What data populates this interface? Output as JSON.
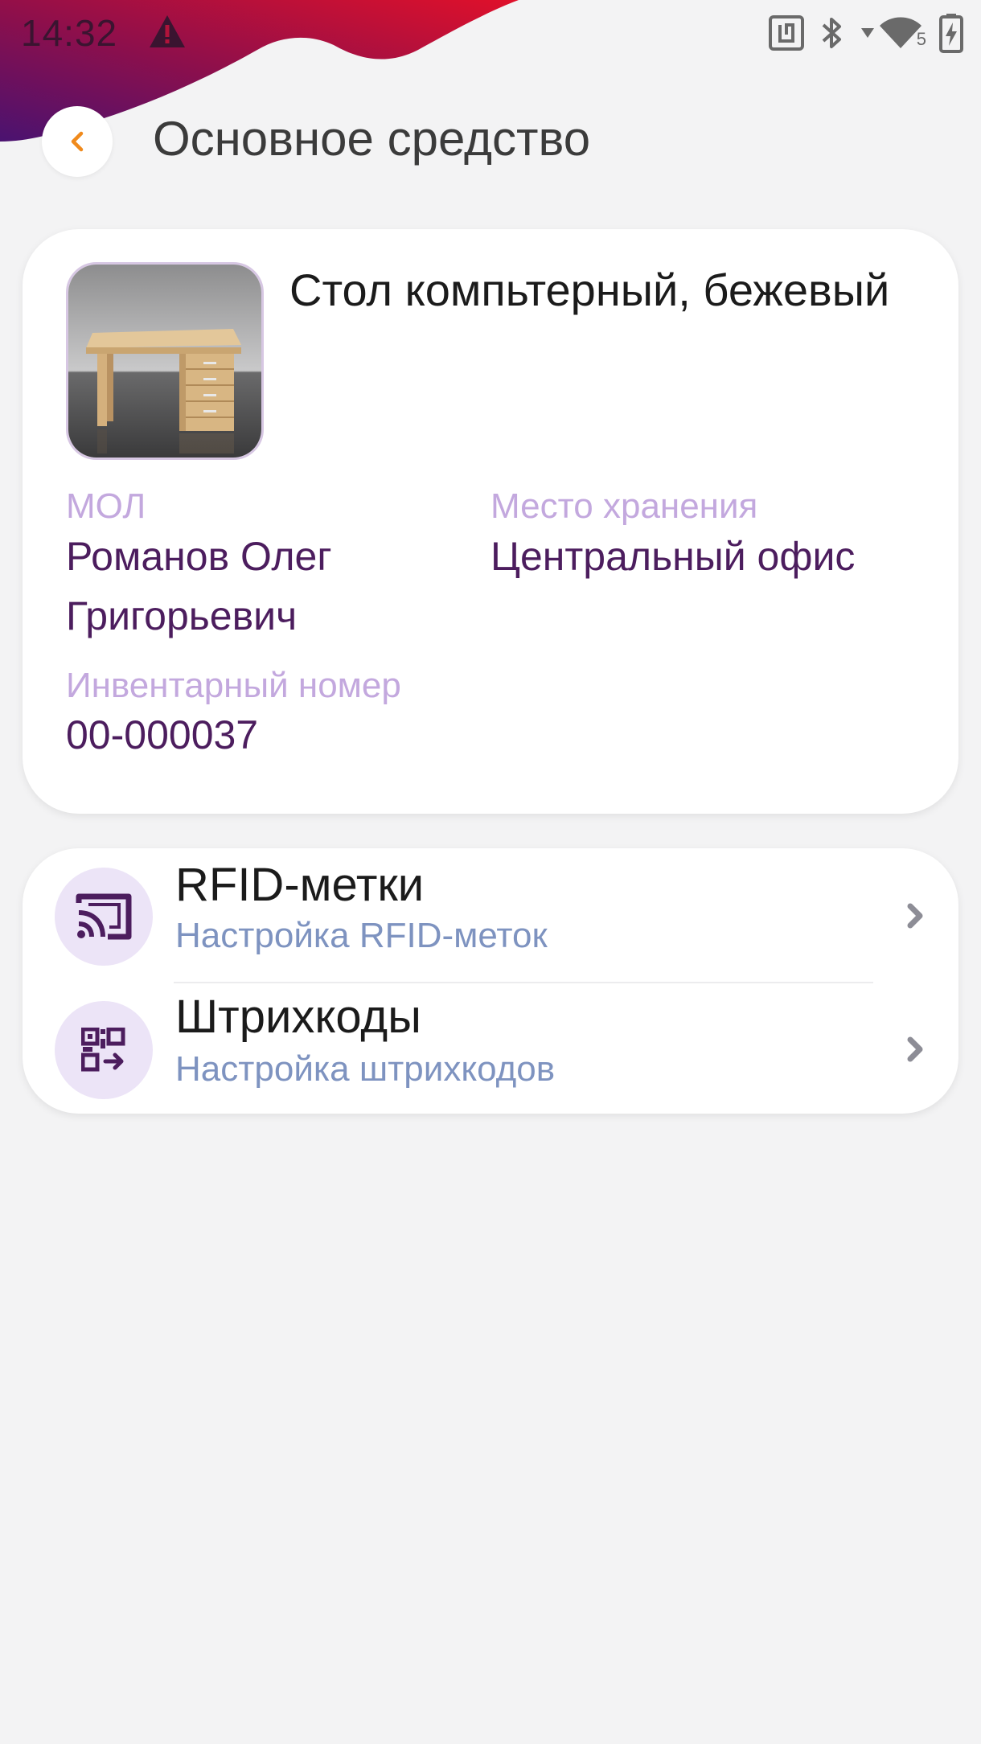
{
  "status_bar": {
    "time": "14:32",
    "icons": [
      "warning-icon",
      "nfc-icon",
      "bluetooth-icon",
      "signal-arrow-icon",
      "wifi-icon",
      "battery-charging-icon"
    ],
    "wifi_badge": "5"
  },
  "header": {
    "back_icon": "chevron-left-icon",
    "title": "Основное средство"
  },
  "asset": {
    "name": "Стол компьтерный, бежевый",
    "image": "computer-desk-beige",
    "responsible": {
      "label": "МОЛ",
      "value": "Романов Олег Григорьевич"
    },
    "location": {
      "label": "Место хранения",
      "value": "Центральный офис"
    },
    "inventory_number": {
      "label": "Инвентарный номер",
      "value": "00-000037"
    }
  },
  "settings": {
    "items": [
      {
        "icon": "rfid-cast-icon",
        "title": "RFID-метки",
        "subtitle": "Настройка RFID-меток"
      },
      {
        "icon": "qr-code-icon",
        "title": "Штрихкоды",
        "subtitle": "Настройка штрихкодов"
      }
    ]
  },
  "colors": {
    "accent_orange": "#f08a1c",
    "label_lavender": "#c3a8de",
    "value_purple": "#4c1d5e",
    "subtitle_blue": "#7e93c0",
    "wave_red": "#d0102e",
    "wave_purple": "#4a1270"
  }
}
